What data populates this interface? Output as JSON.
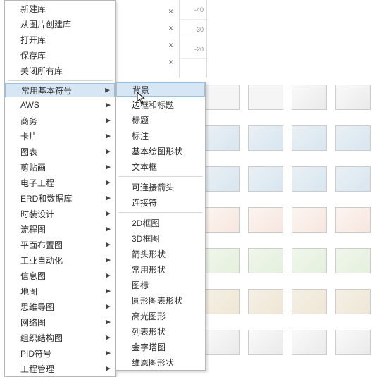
{
  "ruler": {
    "v0": "-40",
    "v1": "-30",
    "v2": "-20"
  },
  "menu1": {
    "top": [
      {
        "label": "新建库"
      },
      {
        "label": "从图片创建库"
      },
      {
        "label": "打开库"
      },
      {
        "label": "保存库"
      },
      {
        "label": "关闭所有库"
      }
    ],
    "categories": [
      {
        "label": "常用基本符号",
        "selected": true
      },
      {
        "label": "AWS"
      },
      {
        "label": "商务"
      },
      {
        "label": "卡片"
      },
      {
        "label": "图表"
      },
      {
        "label": "剪贴画"
      },
      {
        "label": "电子工程"
      },
      {
        "label": "ERD和数据库"
      },
      {
        "label": "时装设计"
      },
      {
        "label": "流程图"
      },
      {
        "label": "平面布置图"
      },
      {
        "label": "工业自动化"
      },
      {
        "label": "信息图"
      },
      {
        "label": "地图"
      },
      {
        "label": "思维导图"
      },
      {
        "label": "网络图"
      },
      {
        "label": "组织结构图"
      },
      {
        "label": "PID符号"
      },
      {
        "label": "工程管理"
      }
    ]
  },
  "menu2": {
    "groups": [
      [
        {
          "label": "背景",
          "highlight": true
        },
        {
          "label": "边框和标题"
        },
        {
          "label": "标题"
        },
        {
          "label": "标注"
        },
        {
          "label": "基本绘图形状"
        },
        {
          "label": "文本框"
        }
      ],
      [
        {
          "label": "可连接箭头"
        },
        {
          "label": "连接符"
        }
      ],
      [
        {
          "label": "2D框图"
        },
        {
          "label": "3D框图"
        },
        {
          "label": "箭头形状"
        },
        {
          "label": "常用形状"
        },
        {
          "label": "图标"
        },
        {
          "label": "圆形图表形状"
        },
        {
          "label": "高光图形"
        },
        {
          "label": "列表形状"
        },
        {
          "label": "金字塔图"
        },
        {
          "label": "维恩图形状"
        }
      ]
    ]
  }
}
